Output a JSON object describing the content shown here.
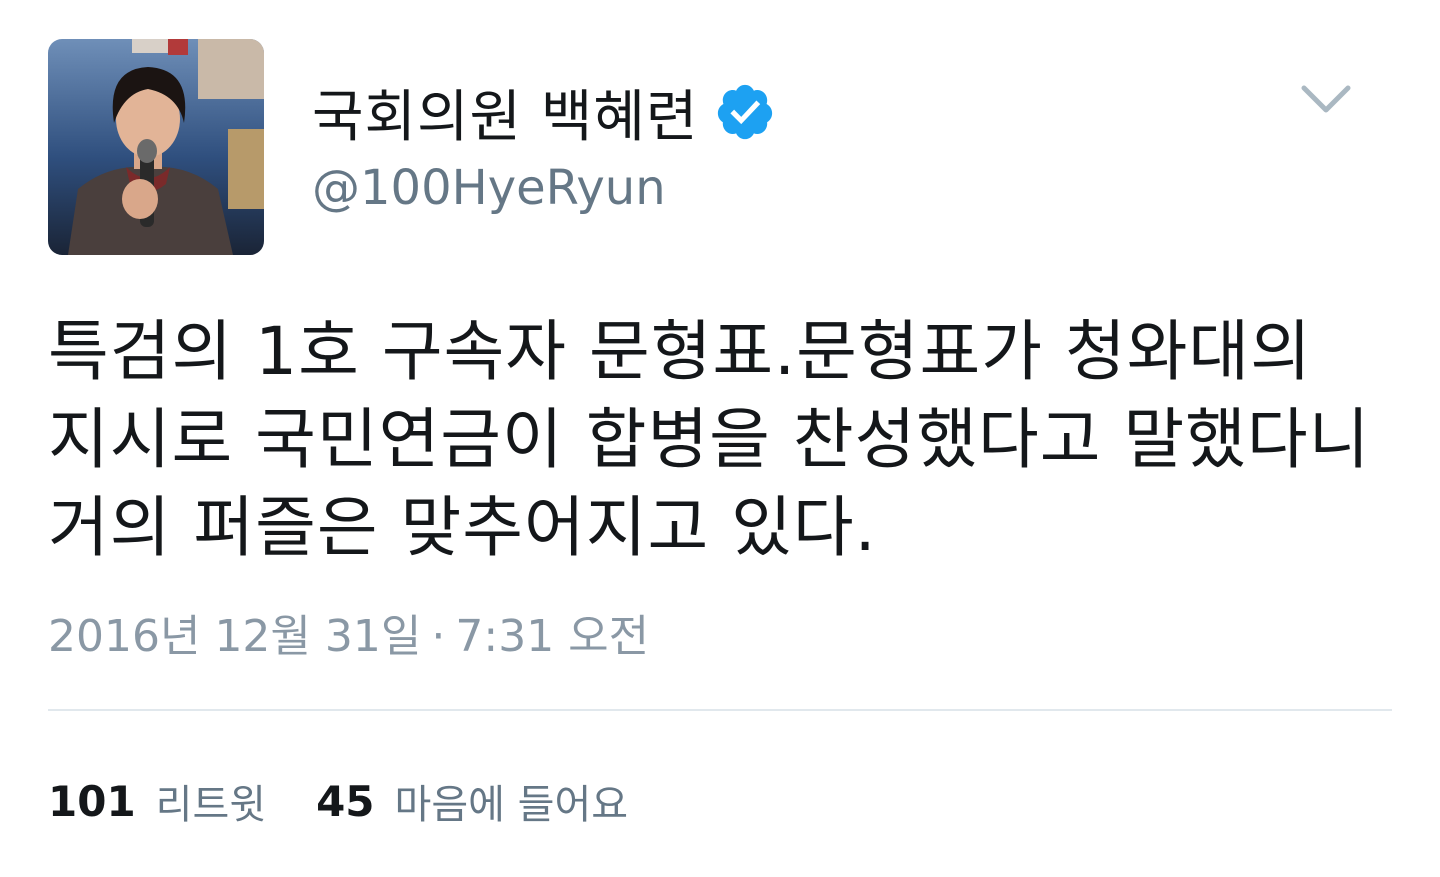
{
  "profile": {
    "avatar_icon": "profile-photo",
    "display_name": "국회의원 백혜련",
    "verified_icon": "verified-badge-icon",
    "handle": "@100HyeRyun",
    "caret_icon": "chevron-down-icon"
  },
  "tweet": {
    "lines": [
      "특검의 1호 구속자 문형표.문형표가 청와대의",
      "지시로 국민연금이 합병을 찬성했다고 말했다니",
      "거의 퍼즐은 맞추어지고 있다."
    ]
  },
  "timestamp": {
    "date": "2016년 12월 31일",
    "separator": "·",
    "time": "7:31 오전"
  },
  "stats": {
    "retweets_count": "101",
    "retweets_label": "리트윗",
    "likes_count": "45",
    "likes_label": "마음에 들어요"
  },
  "colors": {
    "verified": "#1da1f2",
    "secondary_text": "#657786",
    "primary_text": "#14171a",
    "divider": "#e1e8ed"
  }
}
